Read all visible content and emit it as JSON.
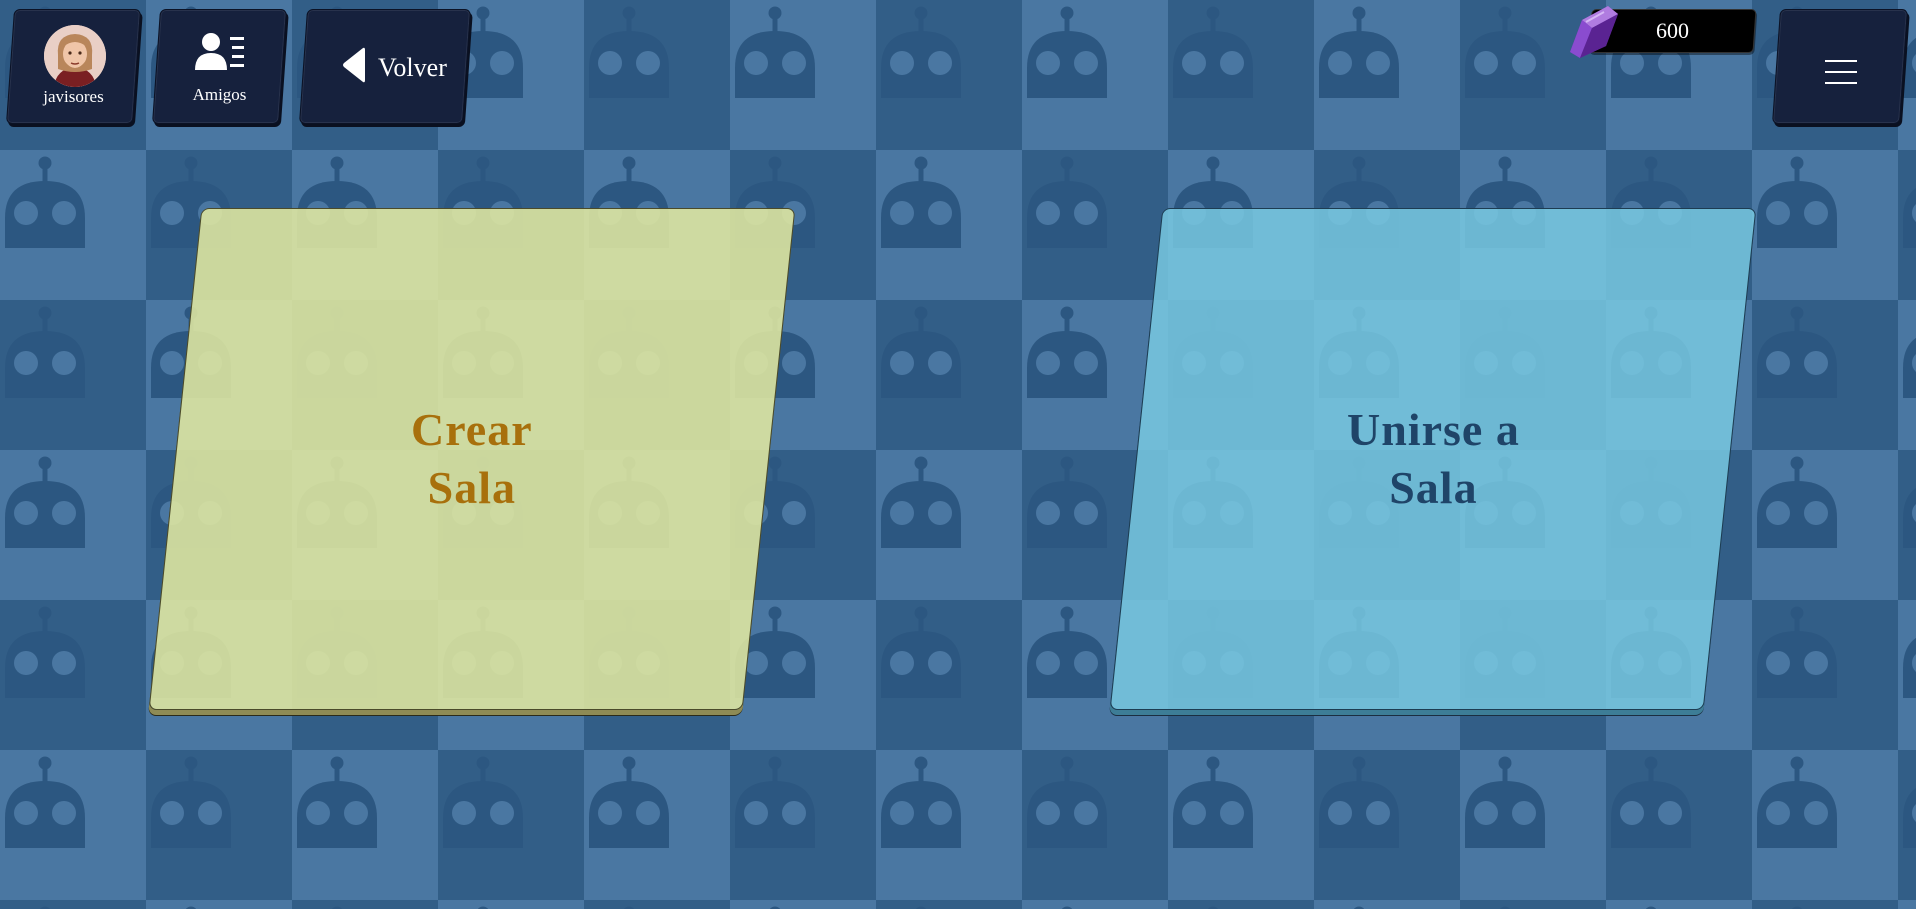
{
  "header": {
    "profile": {
      "username": "javisores",
      "avatar_icon": "avatar-bearded-man-icon"
    },
    "friends": {
      "label": "Amigos",
      "icon": "contact-card-icon"
    },
    "back": {
      "label": "Volver",
      "icon": "back-arrow-icon"
    },
    "currency": {
      "value": "600",
      "icon": "purple-crystal-icon"
    },
    "menu": {
      "icon": "hamburger-menu-icon"
    }
  },
  "cards": {
    "create": {
      "line1": "Crear",
      "line2": "Sala"
    },
    "join": {
      "line1": "Unirse a",
      "line2": "Sala"
    }
  },
  "colors": {
    "background": "#2f5f8a",
    "create_card": "#d5dc9c",
    "create_text": "#a8700c",
    "join_card": "#6fb6d0",
    "join_text": "#1f4468",
    "button_bg": "#16213d"
  }
}
